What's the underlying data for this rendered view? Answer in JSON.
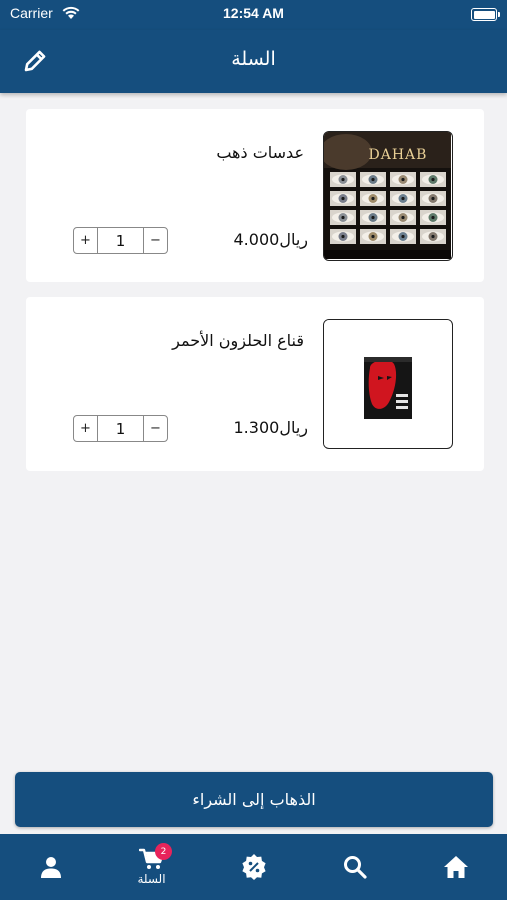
{
  "status_bar": {
    "carrier": "Carrier",
    "time": "12:54 AM"
  },
  "header": {
    "title": "السلة"
  },
  "cart": {
    "items": [
      {
        "name": "عدسات ذهب",
        "price": "4.000ريال",
        "quantity": "1",
        "image_brand": "DAHAB"
      },
      {
        "name": "قناع الحلزون الأحمر",
        "price": "1.300ريال",
        "quantity": "1"
      }
    ],
    "stepper": {
      "plus": "+",
      "minus": "−"
    }
  },
  "checkout": {
    "label": "الذهاب إلى الشراء"
  },
  "tab_bar": {
    "cart_label": "السلة",
    "cart_badge": "2",
    "tabs": [
      "profile-icon",
      "cart-icon",
      "badge-icon",
      "search-icon",
      "home-icon"
    ]
  },
  "colors": {
    "primary": "#154e7e",
    "badge": "#e8245b",
    "background": "#f2f2f4"
  }
}
